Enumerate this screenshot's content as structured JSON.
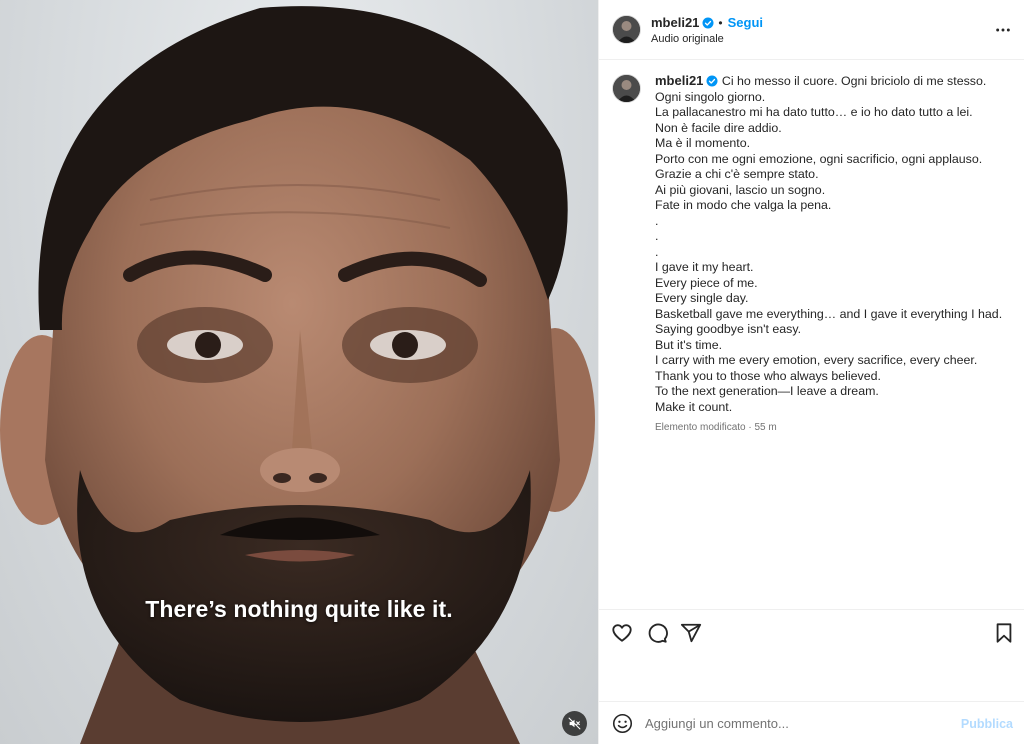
{
  "media": {
    "caption_text": "There’s nothing quite like it.",
    "mute_icon": "speaker-muted-icon"
  },
  "header": {
    "username": "mbeli21",
    "separator": "•",
    "follow_label": "Segui",
    "audio_label": "Audio originale",
    "more_icon": "more-horizontal-icon"
  },
  "caption": {
    "username": "mbeli21",
    "first_line": "Ci ho messo il cuore. Ogni briciolo di me stesso.",
    "lines": [
      "Ogni singolo giorno.",
      "La pallacanestro mi ha dato tutto… e io ho dato tutto a lei.",
      "Non è facile dire addio.",
      "Ma è il momento.",
      "Porto con me ogni emozione, ogni sacrificio, ogni applauso.",
      "Grazie a chi c'è sempre stato.",
      "Ai più giovani, lascio un sogno.",
      "Fate in modo che valga la pena.",
      ".",
      ".",
      ".",
      "I gave it my heart.",
      "Every piece of me.",
      "Every single day.",
      "Basketball gave me everything… and I gave it everything I had.",
      "Saying goodbye isn't easy.",
      "But it's time.",
      "I carry with me every emotion, every sacrifice, every cheer.",
      "Thank you to those who always believed.",
      "To the next generation—I leave a dream.",
      "Make it count."
    ],
    "meta": "Elemento modificato · 55 m"
  },
  "actions": {
    "like_icon": "heart-icon",
    "comment_icon": "comment-icon",
    "share_icon": "send-icon",
    "save_icon": "bookmark-icon"
  },
  "comment_box": {
    "placeholder": "Aggiungi un commento...",
    "value": "",
    "publish_label": "Pubblica",
    "emoji_icon": "emoji-icon"
  },
  "colors": {
    "accent": "#0095f6",
    "publish_disabled": "#b3dbff",
    "text": "#262626",
    "secondary": "#737373"
  }
}
